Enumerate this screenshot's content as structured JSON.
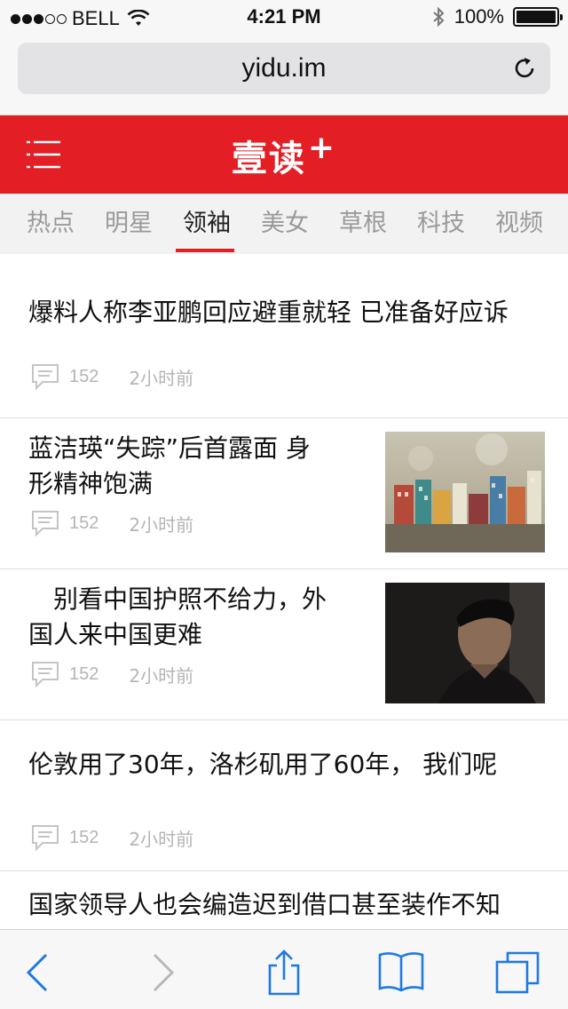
{
  "status_bar": {
    "carrier": "BELL",
    "time": "4:21 PM",
    "battery": "100%",
    "battery_level": 1.0,
    "signal_bars_filled": 3,
    "signal_bars_total": 5
  },
  "browser": {
    "url": "yidu.im",
    "reload_icon": "reload-icon"
  },
  "app_header": {
    "brand": "壹读",
    "brand_suffix": "+",
    "accent_color": "#e31e24",
    "menu_icon": "hamburger-menu-icon"
  },
  "tabs": [
    {
      "label": "热点",
      "active": false
    },
    {
      "label": "明星",
      "active": false
    },
    {
      "label": "领袖",
      "active": true
    },
    {
      "label": "美女",
      "active": false
    },
    {
      "label": "草根",
      "active": false
    },
    {
      "label": "科技",
      "active": false
    },
    {
      "label": "视频",
      "active": false
    }
  ],
  "feed": [
    {
      "title": "爆料人称李亚鹏回应避重就轻 已准备好应诉",
      "comments": "152",
      "time": "2小时前",
      "has_thumb": false
    },
    {
      "title_lines": [
        "蓝洁瑛“失踪”后首露面 身",
        "形精神饱满"
      ],
      "comments": "152",
      "time": "2小时前",
      "thumb": "miniature-houses-photo"
    },
    {
      "title_lines": [
        "　别看中国护照不给力，外",
        "国人来中国更难"
      ],
      "comments": "152",
      "time": "2小时前",
      "thumb": "man-portrait-photo"
    },
    {
      "title": "伦敦用了30年，洛杉矶用了60年， 我们呢",
      "comments": "152",
      "time": "2小时前",
      "has_thumb": false
    },
    {
      "title": "国家领导人也会编造迟到借口甚至装作不知"
    }
  ],
  "toolbar": {
    "back_icon": "back-chevron-icon",
    "forward_icon": "forward-chevron-icon",
    "share_icon": "share-icon",
    "bookmarks_icon": "bookmarks-icon",
    "tabs_icon": "tabs-icon"
  }
}
